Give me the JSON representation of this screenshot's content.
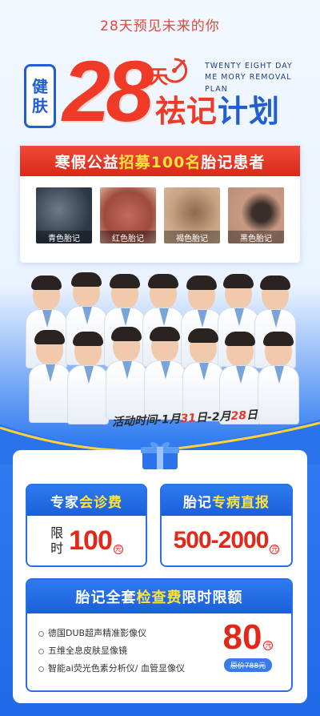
{
  "tagline": "28天预见未来的你",
  "hero": {
    "badge_line1": "健",
    "badge_line2": "肤",
    "big_number": "28",
    "tian": "天",
    "plan_red": "祛记",
    "plan_blue": "计划",
    "english": "TWENTY EIGHT DAY ME MORY REMOVAL PLAN"
  },
  "recruit": {
    "prefix": "寒假公益",
    "highlight": "招募100名",
    "suffix": "胎记患者",
    "photos": [
      {
        "caption": "青色胎记"
      },
      {
        "caption": "红色胎记"
      },
      {
        "caption": "褐色胎记"
      },
      {
        "caption": "黑色胎记"
      }
    ]
  },
  "activity": {
    "label": "活动时间-",
    "date1_pre": "1月",
    "date1_day": "31",
    "date1_post": "日",
    "sep": "-",
    "date2_pre": "2月",
    "date2_day": "28",
    "date2_post": "日"
  },
  "consult": {
    "title_pre": "专家",
    "title_hl": "会诊费",
    "limit_l1": "限",
    "limit_l2": "时",
    "price": "100",
    "unit": "元"
  },
  "direct": {
    "title_pre": "胎记",
    "title_hl": "专病直报",
    "price": "500-2000",
    "unit": "元"
  },
  "exam": {
    "title_pre": "胎记全套",
    "title_hl": "检查费",
    "title_post": "限时限额",
    "items": [
      "德国DUB超声精准影像仪",
      "五维全息皮肤显像镜",
      "智能ai荧光色素分析仪/ 血管显像仪"
    ],
    "price": "80",
    "unit": "元",
    "original": "原价788元"
  },
  "colors": {
    "brand_blue": "#1f5fd0",
    "accent_red": "#ef3a28",
    "highlight_yellow": "#ffe23a"
  }
}
